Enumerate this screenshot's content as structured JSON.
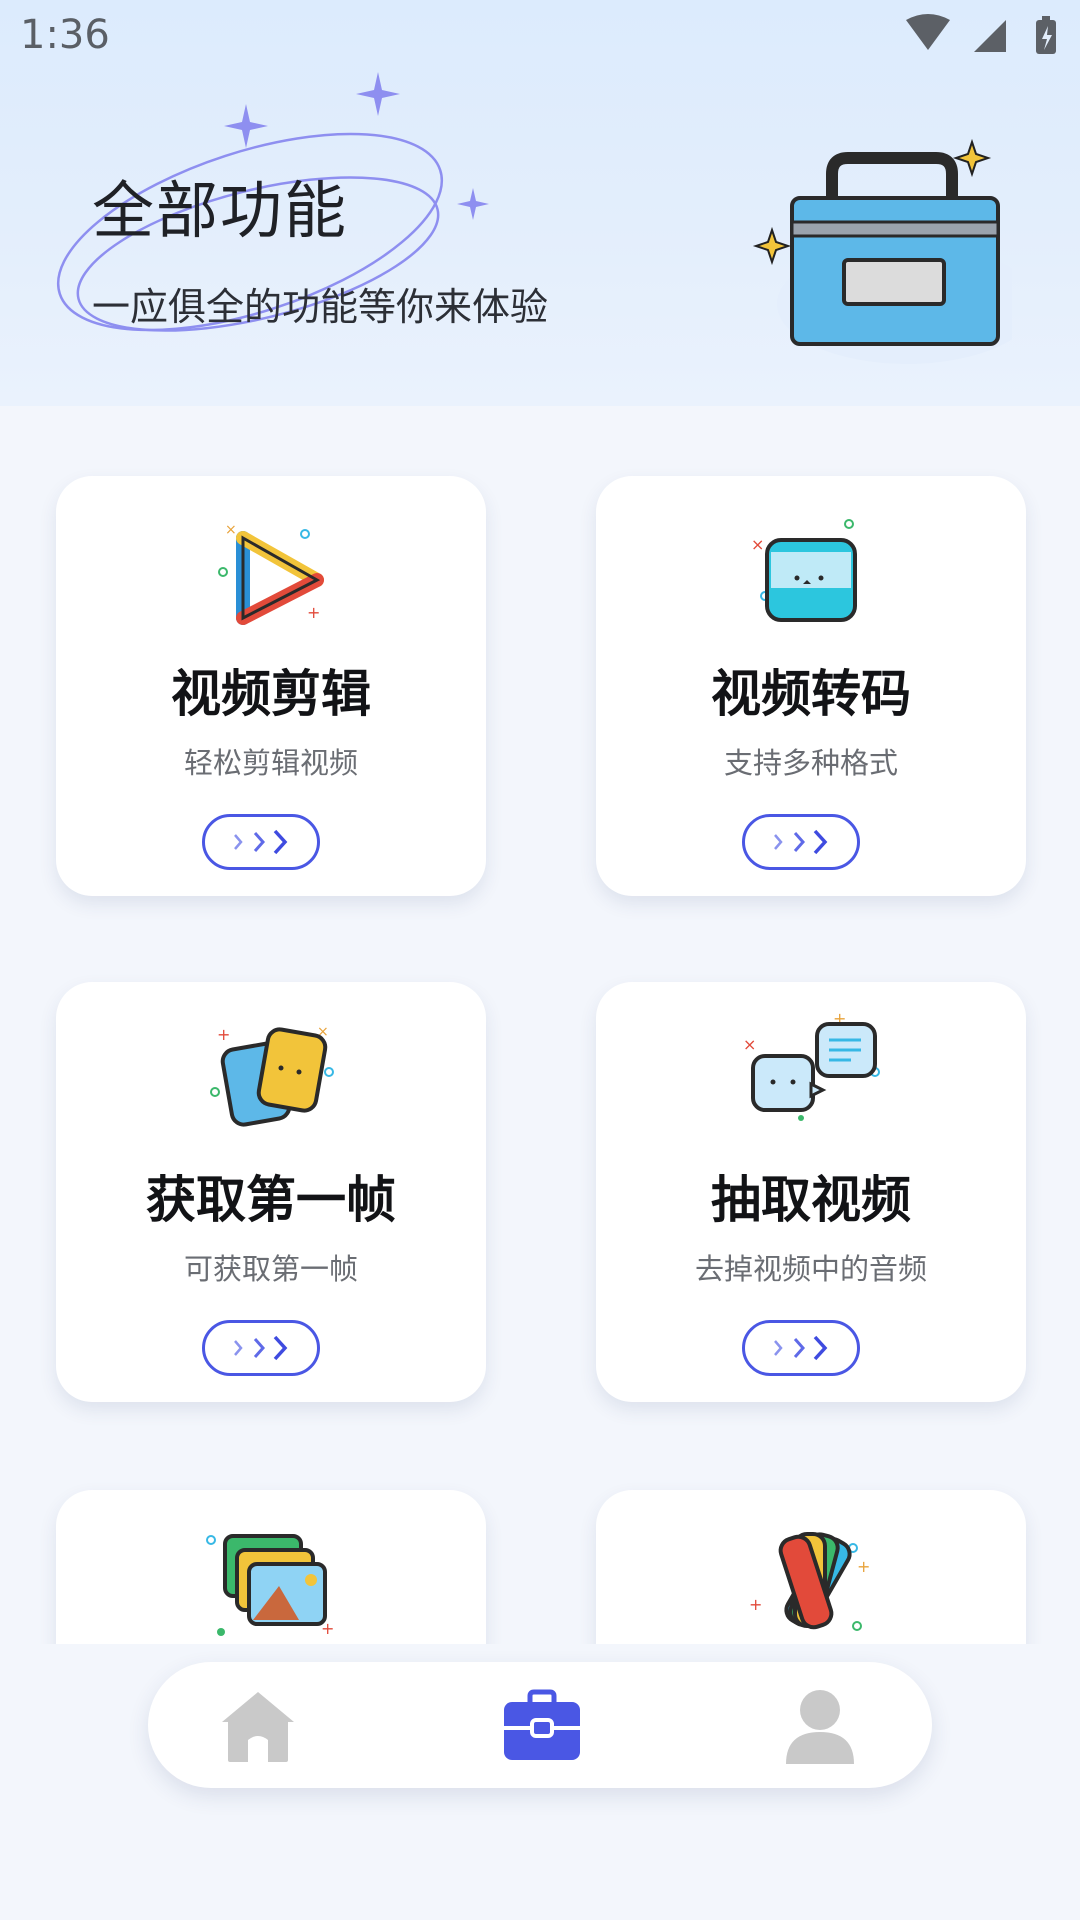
{
  "status_bar": {
    "time": "1:36"
  },
  "header": {
    "title": "全部功能",
    "subtitle": "一应俱全的功能等你来体验",
    "illustration": "toolbox-icon"
  },
  "features": [
    {
      "title": "视频剪辑",
      "desc": "轻松剪辑视频",
      "icon": "video-play-icon"
    },
    {
      "title": "视频转码",
      "desc": "支持多种格式",
      "icon": "screen-scan-icon"
    },
    {
      "title": "获取第一帧",
      "desc": "可获取第一帧",
      "icon": "frame-cards-icon"
    },
    {
      "title": "抽取视频",
      "desc": "去掉视频中的音频",
      "icon": "chat-bubbles-icon"
    },
    {
      "title": "",
      "desc": "",
      "icon": "photo-stack-icon"
    },
    {
      "title": "",
      "desc": "",
      "icon": "color-palette-icon"
    }
  ],
  "bottom_nav": {
    "items": [
      {
        "name": "home",
        "icon": "home-icon",
        "active": false
      },
      {
        "name": "tools",
        "icon": "toolbox-icon",
        "active": true
      },
      {
        "name": "profile",
        "icon": "user-icon",
        "active": false
      }
    ]
  },
  "colors": {
    "accent": "#4a57e4",
    "header_bg": "#dcebfd",
    "page_bg": "#f3f6fc",
    "inactive_icon": "#c9c9c9"
  }
}
